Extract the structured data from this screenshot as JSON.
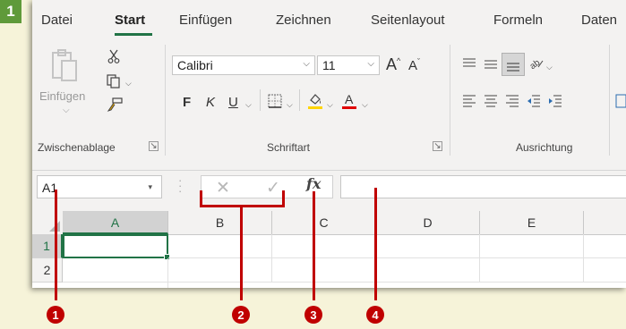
{
  "step": "1",
  "tabs": [
    "Datei",
    "Start",
    "Einfügen",
    "Zeichnen",
    "Seitenlayout",
    "Formeln",
    "Daten"
  ],
  "active_tab": "Start",
  "ribbon": {
    "clipboard": {
      "paste_label": "Einfügen",
      "group_label": "Zwischenablage"
    },
    "font": {
      "font_name": "Calibri",
      "font_size": "11",
      "bold": "F",
      "italic": "K",
      "underline": "U",
      "group_label": "Schriftart"
    },
    "alignment": {
      "group_label": "Ausrichtung"
    }
  },
  "formula_bar": {
    "name_box": "A1",
    "cancel_symbol": "✕",
    "enter_symbol": "✓",
    "fx_label": "fx",
    "formula_value": ""
  },
  "grid": {
    "columns": [
      "A",
      "B",
      "C",
      "D",
      "E"
    ],
    "rows": [
      "1",
      "2"
    ],
    "active_cell": "A1"
  },
  "callouts": [
    "1",
    "2",
    "3",
    "4"
  ],
  "colors": {
    "accent": "#217346",
    "callout": "#c00000",
    "background": "#f6f3d9",
    "step_badge": "#5f9a3a"
  }
}
